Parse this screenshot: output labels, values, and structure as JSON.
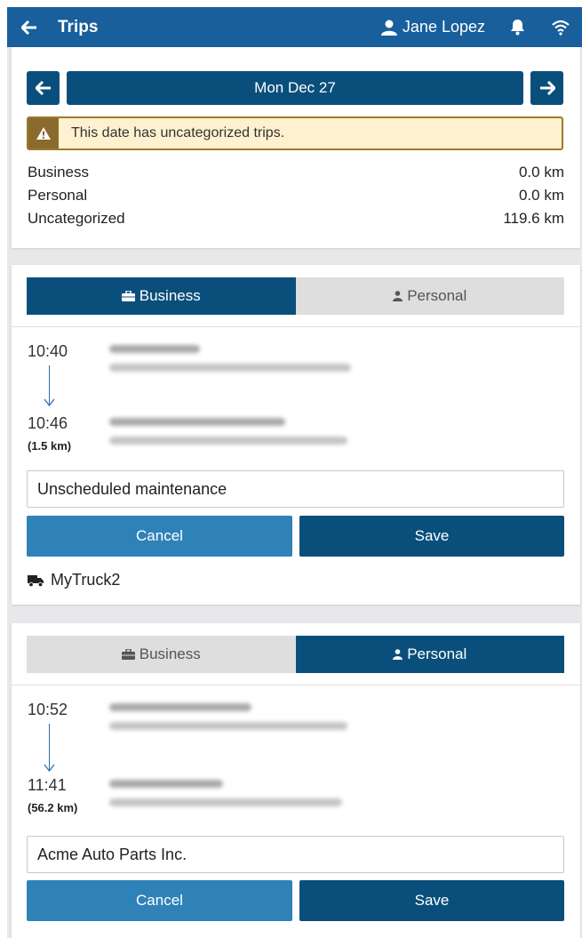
{
  "header": {
    "title": "Trips",
    "user_name": "Jane Lopez"
  },
  "date_nav": {
    "date_label": "Mon Dec 27"
  },
  "alert": {
    "message": "This date has uncategorized trips."
  },
  "totals": [
    {
      "label": "Business",
      "value": "0.0 km"
    },
    {
      "label": "Personal",
      "value": "0.0 km"
    },
    {
      "label": "Uncategorized",
      "value": "119.6 km"
    }
  ],
  "toggle_labels": {
    "business": "Business",
    "personal": "Personal"
  },
  "trips": [
    {
      "selected_category": "Business",
      "start_time": "10:40",
      "end_time": "10:46",
      "distance": "(1.5 km)",
      "description": "Unscheduled maintenance",
      "cancel_label": "Cancel",
      "save_label": "Save",
      "vehicle": "MyTruck2"
    },
    {
      "selected_category": "Personal",
      "start_time": "10:52",
      "end_time": "11:41",
      "distance": "(56.2 km)",
      "description": "Acme Auto Parts Inc.",
      "cancel_label": "Cancel",
      "save_label": "Save"
    }
  ],
  "colors": {
    "header_blue": "#185f9c",
    "primary_dark": "#0a4f7b",
    "cancel_blue": "#2f82b8",
    "alert_bg": "#fdf1cf",
    "alert_border": "#9e7a2c"
  }
}
